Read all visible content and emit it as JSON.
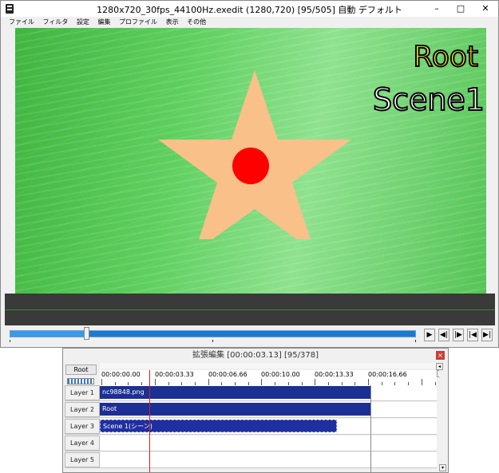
{
  "window": {
    "title": "1280x720_30fps_44100Hz.exedit (1280,720)  [95/505]  自動  デフォルト",
    "minimize": "–",
    "maximize": "□",
    "close": "✕"
  },
  "menu": [
    "ファイル",
    "フィルタ",
    "設定",
    "編集",
    "プロファイル",
    "表示",
    "その他"
  ],
  "preview": {
    "text_root": "Root",
    "text_scene": "Scene1",
    "colors": {
      "star": "#f9c08a",
      "dot": "#ff0000",
      "root_text": "#ffee00",
      "scene_text": "#ffffff",
      "background": "#5fcf5f"
    }
  },
  "playback": {
    "position_fraction": 0.188,
    "buttons": [
      {
        "name": "play-icon",
        "glyph": "▶"
      },
      {
        "name": "step-back-icon",
        "glyph": "◀|"
      },
      {
        "name": "step-forward-icon",
        "glyph": "|▶"
      },
      {
        "name": "skip-start-icon",
        "glyph": "|◀"
      },
      {
        "name": "skip-end-icon",
        "glyph": "▶|"
      }
    ]
  },
  "timeline": {
    "title": "拡張編集 [00:00:03.13] [95/378]",
    "close": "×",
    "root_tab": "Root",
    "ruler": [
      "00:00:00.00",
      "00:00:03.33",
      "00:00:06.66",
      "00:00:10.00",
      "00:00:13.33",
      "00:00:16.66"
    ],
    "layers": [
      {
        "label": "Layer 1",
        "clip": "nc98848.png"
      },
      {
        "label": "Layer 2",
        "clip": "Root"
      },
      {
        "label": "Layer 3",
        "clip": "Scene 1(シーン)"
      },
      {
        "label": "Layer 4",
        "clip": ""
      },
      {
        "label": "Layer 5",
        "clip": ""
      }
    ]
  }
}
